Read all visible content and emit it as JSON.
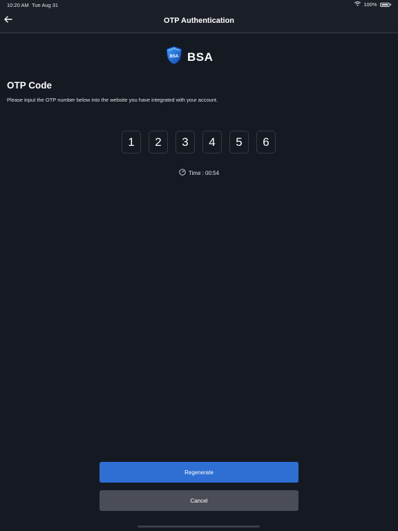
{
  "status_bar": {
    "time": "10:20 AM",
    "date": "Tue Aug 31",
    "battery": "100%",
    "icons": [
      "wifi-icon",
      "battery-icon"
    ]
  },
  "nav": {
    "title": "OTP Authentication",
    "back_icon": "arrow-left-icon"
  },
  "logo": {
    "text": "BSA",
    "badge_text": "BSA"
  },
  "otp": {
    "title": "OTP Code",
    "instruction": "Please input the OTP number below into the website you have integrated with your account.",
    "digits": [
      "1",
      "2",
      "3",
      "4",
      "5",
      "6"
    ],
    "timer_label": "Time : 00:54",
    "timer_icon": "clock-icon"
  },
  "actions": {
    "regenerate_label": "Regenerate",
    "cancel_label": "Cancel"
  },
  "colors": {
    "background": "#151922",
    "primary": "#2f6fd3",
    "secondary": "#4a4d55",
    "box_border": "#343a45"
  }
}
